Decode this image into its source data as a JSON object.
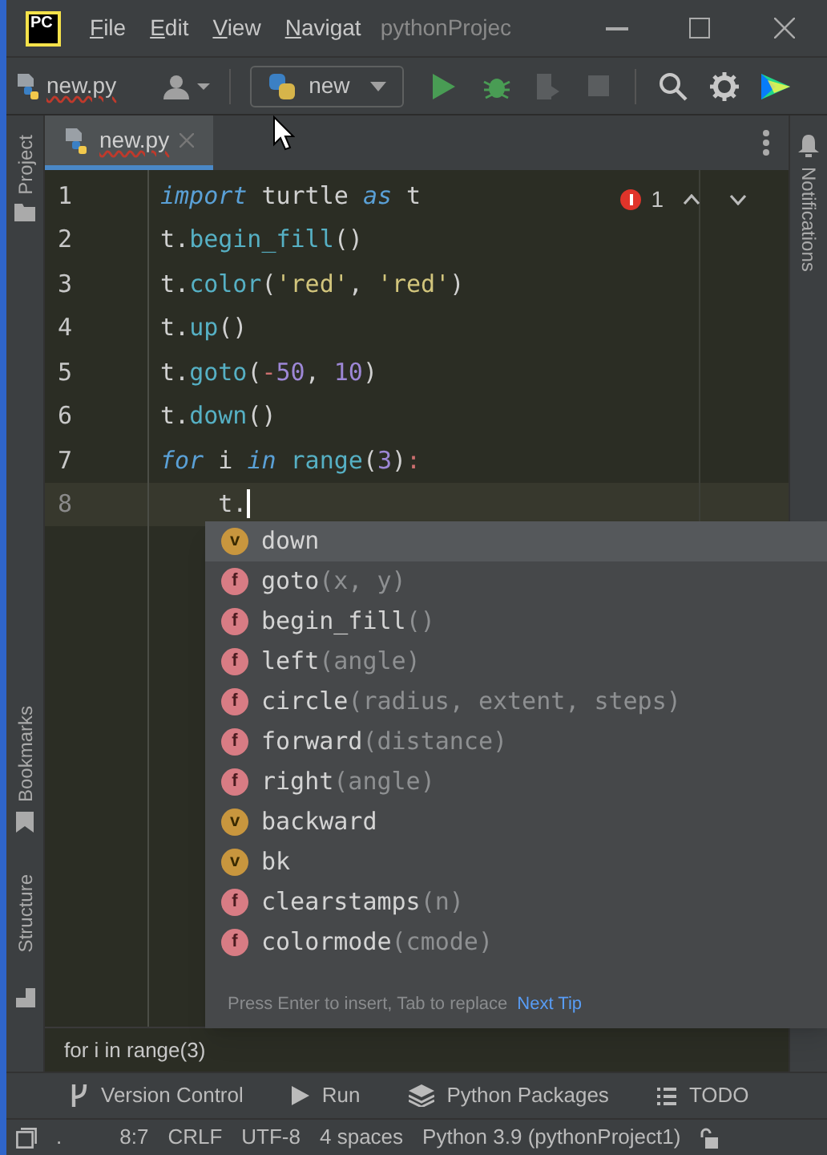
{
  "title_bar": {
    "logo": "PC",
    "menus": [
      "File",
      "Edit",
      "View",
      "Navigat"
    ],
    "project": "pythonProjec"
  },
  "toolbar": {
    "file": "new.py",
    "run_config": "new"
  },
  "editor_tabs": [
    {
      "label": "new.py",
      "selected": true
    }
  ],
  "side_tabs_left": [
    "Project",
    "Bookmarks",
    "Structure"
  ],
  "side_tabs_right": [
    "Notifications"
  ],
  "editor": {
    "problems": "1",
    "lines": [
      {
        "number": "1",
        "current": false,
        "tokens": [
          {
            "text": "import",
            "kind": "keyword"
          },
          {
            "text": " turtle ",
            "kind": "plain"
          },
          {
            "text": "as",
            "kind": "keyword"
          },
          {
            "text": " t",
            "kind": "plain"
          }
        ]
      },
      {
        "number": "2",
        "current": false,
        "tokens": [
          {
            "text": "t.",
            "kind": "plain"
          },
          {
            "text": "begin_fill",
            "kind": "function"
          },
          {
            "text": "()",
            "kind": "plain"
          }
        ]
      },
      {
        "number": "3",
        "current": false,
        "tokens": [
          {
            "text": "t.",
            "kind": "plain"
          },
          {
            "text": "color",
            "kind": "function"
          },
          {
            "text": "(",
            "kind": "plain"
          },
          {
            "text": "'red'",
            "kind": "string"
          },
          {
            "text": ", ",
            "kind": "plain"
          },
          {
            "text": "'red'",
            "kind": "string"
          },
          {
            "text": ")",
            "kind": "plain"
          }
        ]
      },
      {
        "number": "4",
        "current": false,
        "tokens": [
          {
            "text": "t.",
            "kind": "plain"
          },
          {
            "text": "up",
            "kind": "function"
          },
          {
            "text": "()",
            "kind": "plain"
          }
        ]
      },
      {
        "number": "5",
        "current": false,
        "tokens": [
          {
            "text": "t.",
            "kind": "plain"
          },
          {
            "text": "goto",
            "kind": "function"
          },
          {
            "text": "(",
            "kind": "plain"
          },
          {
            "text": "-",
            "kind": "operator"
          },
          {
            "text": "50",
            "kind": "number"
          },
          {
            "text": ", ",
            "kind": "plain"
          },
          {
            "text": "10",
            "kind": "number"
          },
          {
            "text": ")",
            "kind": "plain"
          }
        ]
      },
      {
        "number": "6",
        "current": false,
        "tokens": [
          {
            "text": "t.",
            "kind": "plain"
          },
          {
            "text": "down",
            "kind": "function"
          },
          {
            "text": "()",
            "kind": "plain"
          }
        ]
      },
      {
        "number": "7",
        "current": false,
        "tokens": [
          {
            "text": "for",
            "kind": "keyword"
          },
          {
            "text": " i ",
            "kind": "plain"
          },
          {
            "text": "in ",
            "kind": "keyword"
          },
          {
            "text": "range",
            "kind": "function"
          },
          {
            "text": "(",
            "kind": "plain"
          },
          {
            "text": "3",
            "kind": "number"
          },
          {
            "text": ")",
            "kind": "plain"
          },
          {
            "text": ":",
            "kind": "operator"
          }
        ]
      },
      {
        "number": "8",
        "current": true,
        "tokens": [
          {
            "text": "    t.",
            "kind": "plain"
          }
        ]
      }
    ]
  },
  "completion": {
    "items": [
      {
        "kind": "variable",
        "badge": "v",
        "name": "down",
        "selected": true
      },
      {
        "kind": "function",
        "badge": "f",
        "name": "goto",
        "params": "(x, y)",
        "selected": false
      },
      {
        "kind": "function",
        "badge": "f",
        "name": "begin_fill",
        "params": "()",
        "selected": false
      },
      {
        "kind": "function",
        "badge": "f",
        "name": "left",
        "params": "(angle)",
        "selected": false
      },
      {
        "kind": "function",
        "badge": "f",
        "name": "circle",
        "params": "(radius, extent, steps)",
        "selected": false
      },
      {
        "kind": "function",
        "badge": "f",
        "name": "forward",
        "params": "(distance)",
        "selected": false
      },
      {
        "kind": "function",
        "badge": "f",
        "name": "right",
        "params": "(angle)",
        "selected": false
      },
      {
        "kind": "variable",
        "badge": "v",
        "name": "backward",
        "selected": false
      },
      {
        "kind": "variable",
        "badge": "v",
        "name": "bk",
        "selected": false
      },
      {
        "kind": "function",
        "badge": "f",
        "name": "clearstamps",
        "params": "(n)",
        "selected": false
      },
      {
        "kind": "function",
        "badge": "f",
        "name": "colormode",
        "params": "(cmode)",
        "selected": false
      }
    ],
    "hint": "Press Enter to insert, Tab to replace",
    "link": "Next Tip"
  },
  "breadcrumb": "for i in range(3)",
  "tool_windows": [
    {
      "kind": "vcs",
      "label": "Version Control"
    },
    {
      "kind": "run",
      "label": "Run"
    },
    {
      "kind": "packages",
      "label": "Python Packages"
    },
    {
      "kind": "todo",
      "label": "TODO"
    }
  ],
  "status_bar": {
    "items": [
      ".",
      "8:7",
      "CRLF",
      "UTF-8",
      "4 spaces",
      "Python 3.9 (pythonProject1)"
    ]
  }
}
